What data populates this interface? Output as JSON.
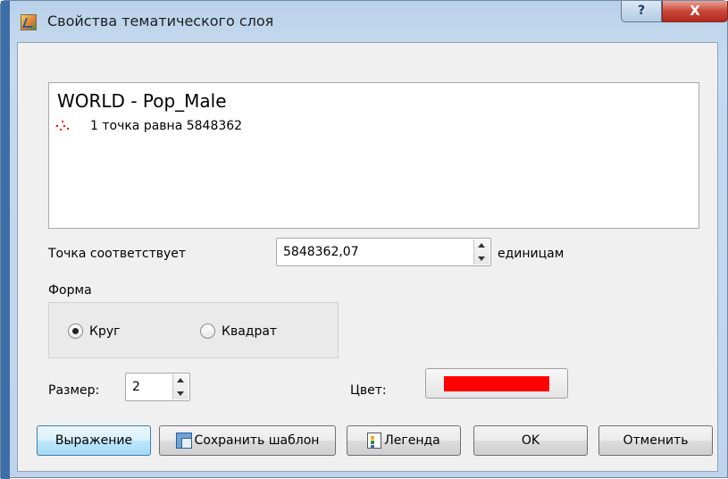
{
  "window": {
    "title": "Свойства тематического слоя",
    "help_label": "?",
    "close_label": "X"
  },
  "legend": {
    "title": "WORLD - Pop_Male",
    "dot_text": "1 точка равна 5848362",
    "dot_color": "#ff0000"
  },
  "point": {
    "label": "Точка соответствует",
    "value": "5848362,07",
    "units_label": "единицам"
  },
  "shape": {
    "label": "Форма",
    "options": [
      {
        "label": "Круг",
        "checked": true
      },
      {
        "label": "Квадрат",
        "checked": false
      }
    ]
  },
  "size": {
    "label": "Размер:",
    "value": "2"
  },
  "color": {
    "label": "Цвет:",
    "value": "#ff0000"
  },
  "buttons": {
    "expression": "Выражение",
    "save_template": "Сохранить шаблон",
    "legend": "Легенда",
    "ok": "OK",
    "cancel": "Отменить"
  }
}
